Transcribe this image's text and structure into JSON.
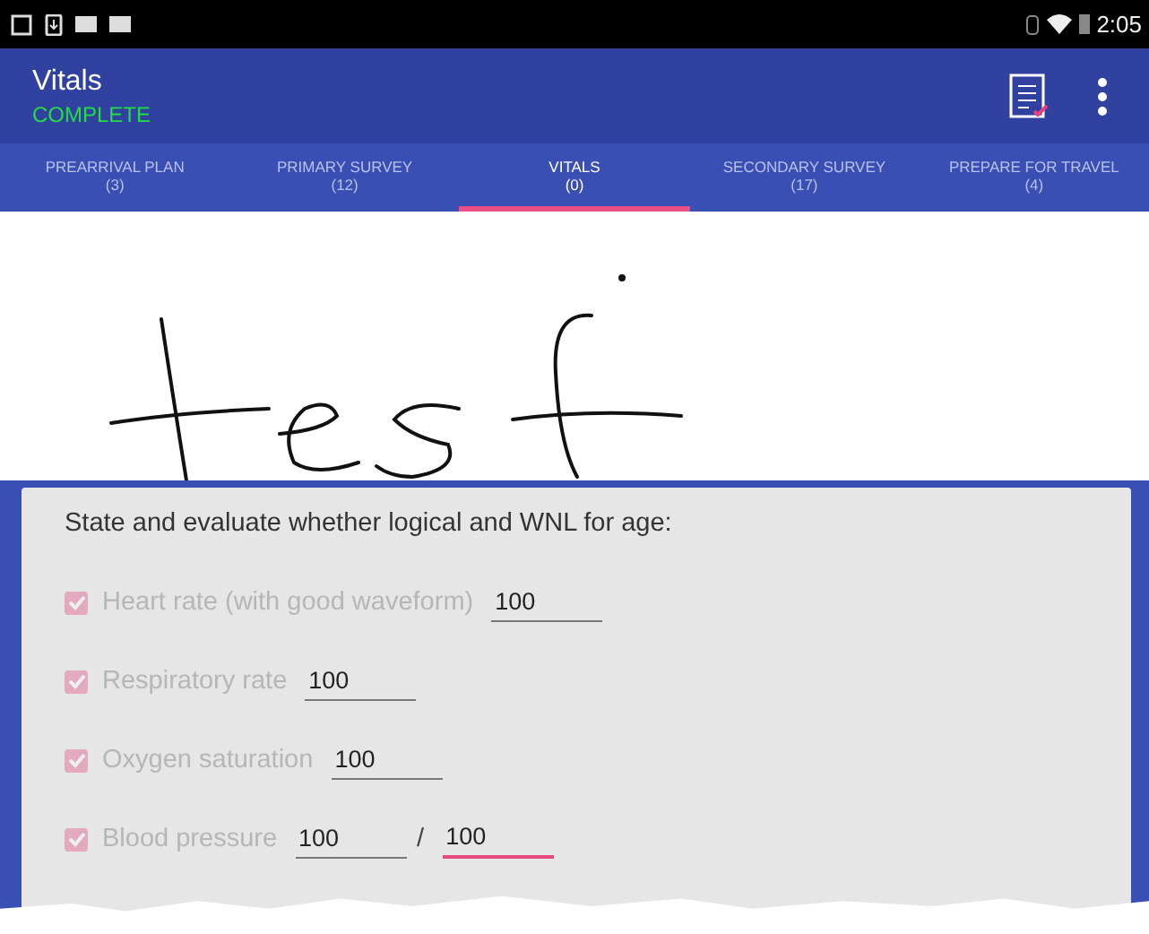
{
  "status_bar": {
    "time": "2:05"
  },
  "toolbar": {
    "title": "Vitals",
    "status": "COMPLETE"
  },
  "tabs": [
    {
      "label": "PREARRIVAL PLAN",
      "count": "(3)",
      "selected": false
    },
    {
      "label": "PRIMARY SURVEY",
      "count": "(12)",
      "selected": false
    },
    {
      "label": "VITALS",
      "count": "(0)",
      "selected": true
    },
    {
      "label": "SECONDARY SURVEY",
      "count": "(17)",
      "selected": false
    },
    {
      "label": "PREPARE FOR TRAVEL",
      "count": "(4)",
      "selected": false
    }
  ],
  "form": {
    "prompt": "State and evaluate whether logical and WNL for age:",
    "items": [
      {
        "label": "Heart rate (with good waveform)",
        "checked": true,
        "disabled": true,
        "fields": [
          {
            "value": "100",
            "focused": false
          }
        ]
      },
      {
        "label": "Respiratory rate",
        "checked": true,
        "disabled": true,
        "fields": [
          {
            "value": "100",
            "focused": false
          }
        ]
      },
      {
        "label": "Oxygen saturation",
        "checked": true,
        "disabled": true,
        "fields": [
          {
            "value": "100",
            "focused": false
          }
        ]
      },
      {
        "label": "Blood pressure",
        "checked": true,
        "disabled": true,
        "separator": "/",
        "fields": [
          {
            "value": "100",
            "focused": false
          },
          {
            "value": "100",
            "focused": true
          }
        ]
      }
    ]
  }
}
